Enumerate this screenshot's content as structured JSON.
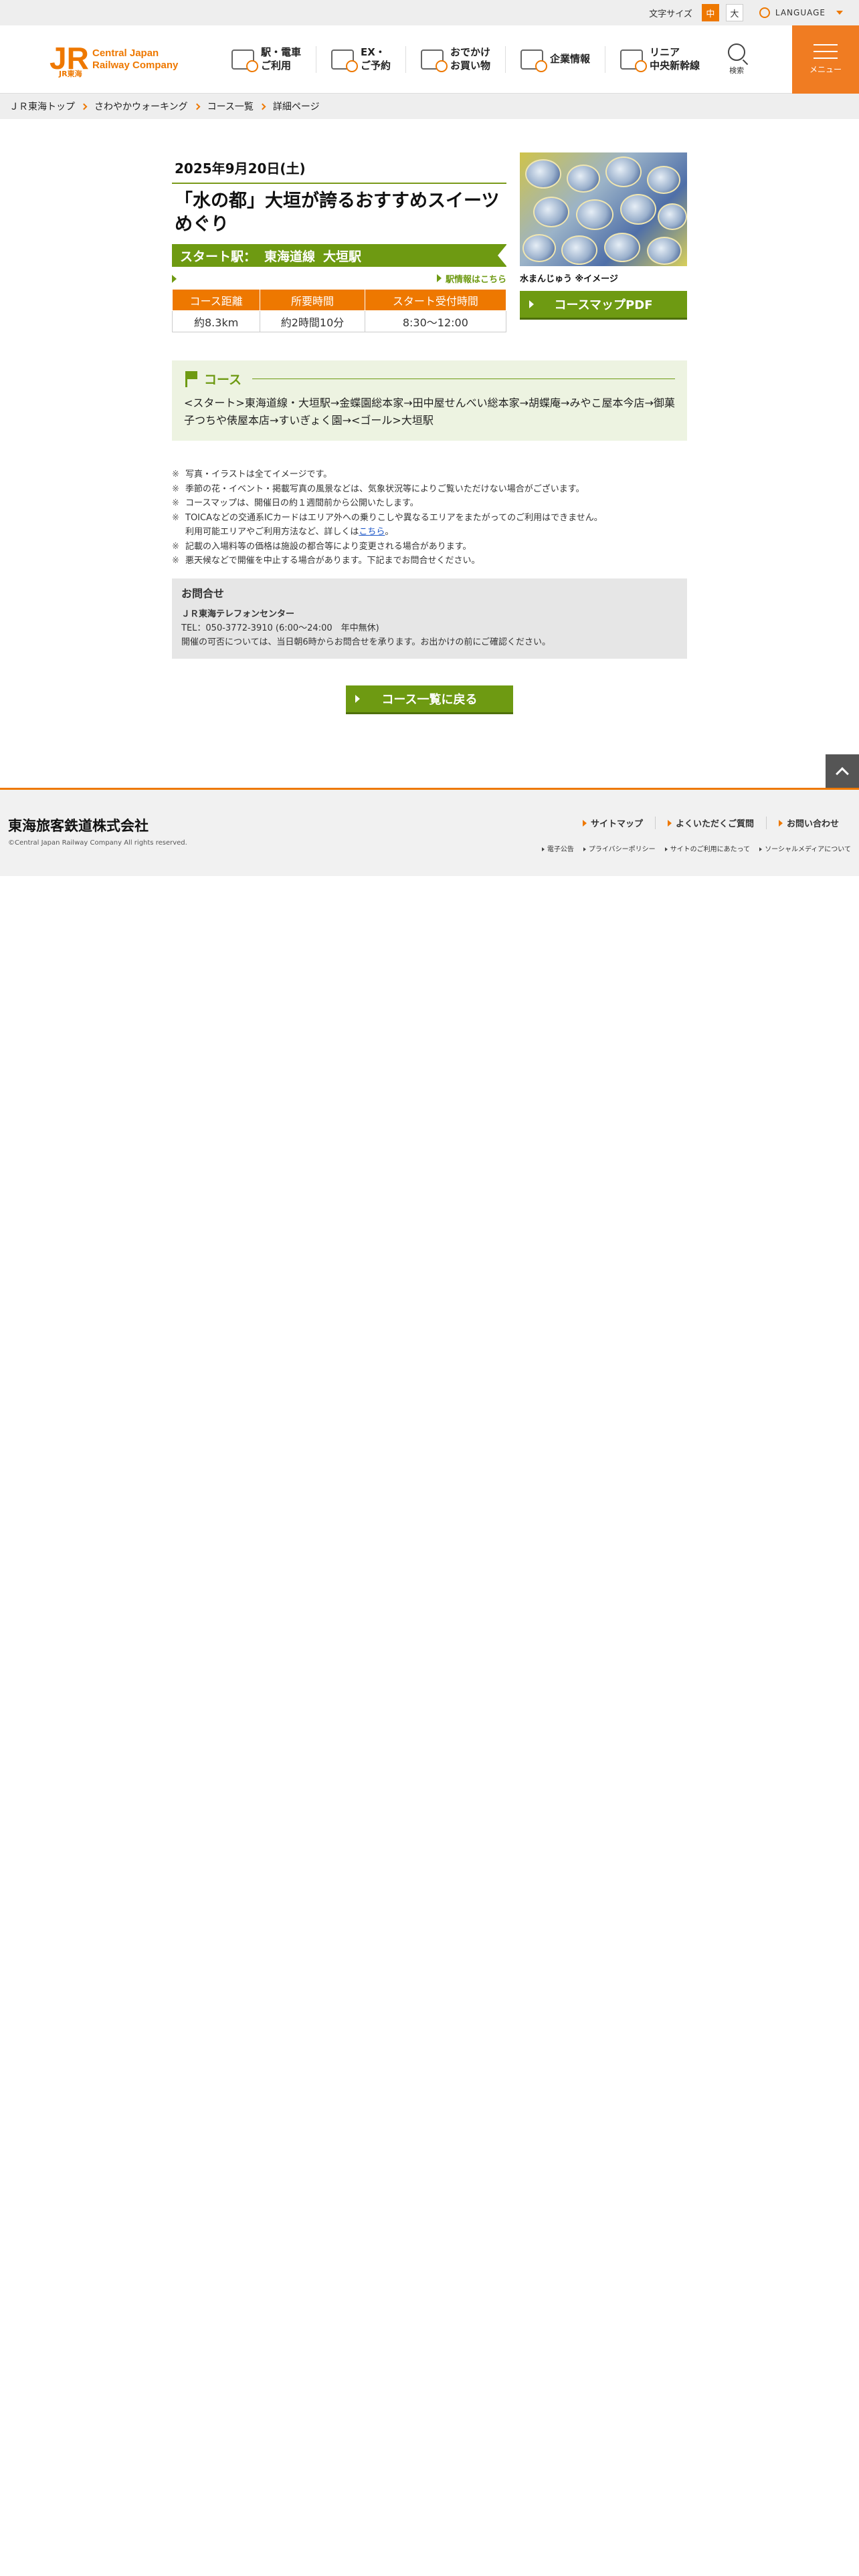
{
  "topbar": {
    "font_size_label": "文字サイズ",
    "font_medium": "中",
    "font_large": "大",
    "language": "LANGUAGE"
  },
  "header": {
    "logo_sub": "JR東海",
    "logo_text_1": "Central Japan",
    "logo_text_2": "Railway Company",
    "nav": [
      {
        "line1": "駅・電車",
        "line2": "ご利用"
      },
      {
        "line1": "EX・",
        "line2": "ご予約"
      },
      {
        "line1": "おでかけ",
        "line2": "お買い物"
      },
      {
        "line1": "企業情報",
        "line2": ""
      },
      {
        "line1": "リニア",
        "line2": "中央新幹線"
      }
    ],
    "search_label": "検索",
    "menu_label": "メニュー"
  },
  "breadcrumb": [
    "ＪＲ東海トップ",
    "さわやかウォーキング",
    "コース一覧",
    "詳細ページ"
  ],
  "event": {
    "date": "2025年9月20日(土)",
    "title": "「水の都」大垣が誇るおすすめスイーツめぐり",
    "start_label": "スタート駅：",
    "start_line": "東海道線",
    "start_station": "大垣駅",
    "station_info_link": "駅情報はこちら",
    "table_headers": [
      "コース距離",
      "所要時間",
      "スタート受付時間"
    ],
    "table_values": [
      "約8.3km",
      "約2時間10分",
      "8:30〜12:00"
    ],
    "photo_caption": "水まんじゅう ※イメージ",
    "pdf_button": "コースマップPDF"
  },
  "course": {
    "label": "コース",
    "text": "<スタート>東海道線・大垣駅→金蝶園総本家→田中屋せんべい総本家→胡蝶庵→みやこ屋本今店→御菓子つちや俵屋本店→すいぎょく園→<ゴール>大垣駅"
  },
  "notes": [
    "写真・イラストは全てイメージです。",
    "季節の花・イベント・掲載写真の風景などは、気象状況等によりご覧いただけない場合がございます。",
    "コースマップは、開催日の約１週間前から公開いたします。",
    "TOICAなどの交通系ICカードはエリア外への乗りこしや異なるエリアをまたがってのご利用はできません。",
    "記載の入場料等の価格は施設の都合等により変更される場合があります。",
    "悪天候などで開催を中止する場合があります。下記までお問合せください。"
  ],
  "note_extra": {
    "before_link": "利用可能エリアやご利用方法など、詳しくは",
    "link": "こちら",
    "after_link": "。"
  },
  "contact": {
    "title": "お問合せ",
    "name": "ＪＲ東海テレフォンセンター",
    "tel": "TEL：050-3772-3910 (6:00〜24:00　年中無休)",
    "note": "開催の可否については、当日朝6時からお問合せを承ります。お出かけの前にご確認ください。"
  },
  "back_button": "コース一覧に戻る",
  "footer": {
    "company": "東海旅客鉄道株式会社",
    "copyright": "©Central Japan Railway Company All rights reserved.",
    "links": [
      "サイトマップ",
      "よくいただくご質問",
      "お問い合わせ"
    ],
    "sub_links": [
      "電子公告",
      "プライバシーポリシー",
      "サイトのご利用にあたって",
      "ソーシャルメディアについて"
    ]
  },
  "colors": {
    "brand_orange": "#ee7800",
    "green": "#6e9a12",
    "course_bg": "#edf3e1"
  }
}
